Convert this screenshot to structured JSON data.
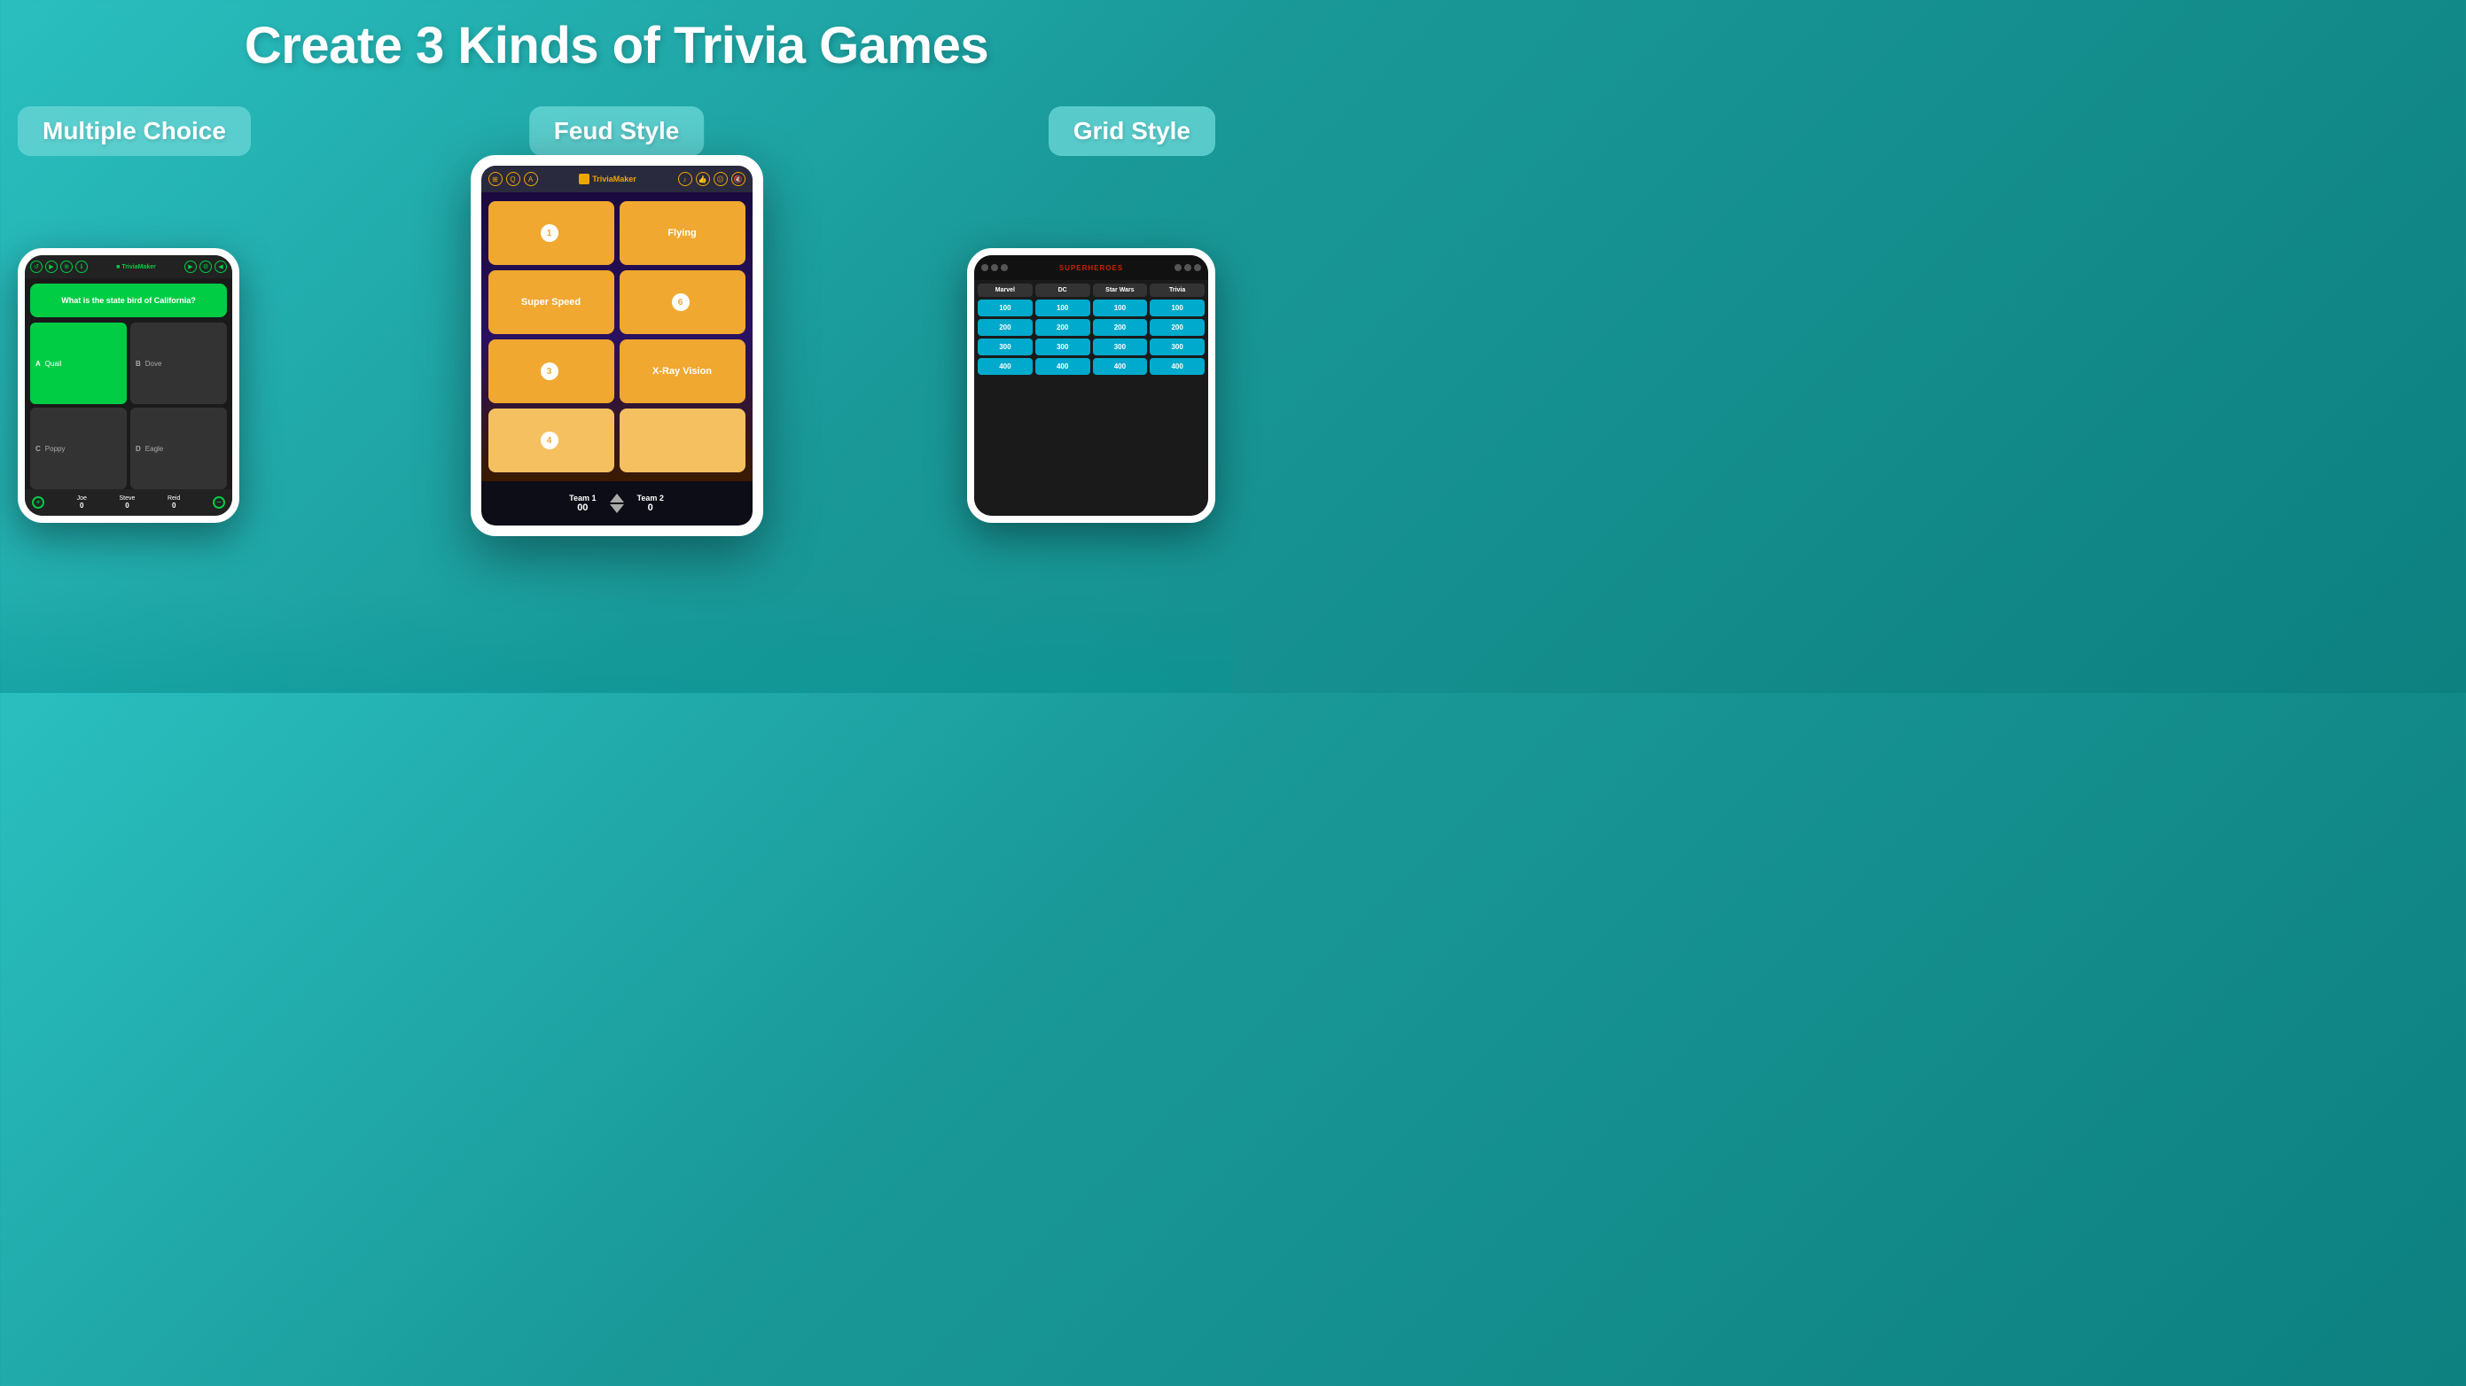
{
  "title": "Create 3 Kinds of Trivia Games",
  "badges": {
    "multiple_choice": "Multiple Choice",
    "feud_style": "Feud Style",
    "grid_style": "Grid Style"
  },
  "feud": {
    "app_name": "TriviaMaker",
    "cells": [
      {
        "type": "number",
        "value": "1"
      },
      {
        "type": "answer",
        "value": "Flying"
      },
      {
        "type": "answer",
        "value": "Super Speed"
      },
      {
        "type": "number",
        "value": "6"
      },
      {
        "type": "number",
        "value": "3"
      },
      {
        "type": "answer",
        "value": "X-Ray Vision"
      },
      {
        "type": "number",
        "value": "4"
      },
      {
        "type": "empty",
        "value": ""
      }
    ],
    "team1": {
      "label": "Team 1",
      "score": "00"
    },
    "team2": {
      "label": "Team 2",
      "score": "0"
    }
  },
  "multiple_choice": {
    "app_name": "TriviaMaker",
    "question": "What is the state bird of California?",
    "answers": [
      {
        "letter": "A",
        "text": "Quail",
        "correct": true
      },
      {
        "letter": "B",
        "text": "Dove",
        "correct": false
      },
      {
        "letter": "C",
        "text": "Poppy",
        "correct": false
      },
      {
        "letter": "D",
        "text": "Eagle",
        "correct": false
      }
    ],
    "players": [
      {
        "name": "Joe",
        "score": "0"
      },
      {
        "name": "Steve",
        "score": "0"
      },
      {
        "name": "Reid",
        "score": "0"
      }
    ]
  },
  "grid": {
    "app_name": "SUPERHEROES",
    "columns": [
      "Marvel",
      "DC",
      "Star Wars",
      "Trivia"
    ],
    "rows": [
      [
        "100",
        "100",
        "100",
        "100"
      ],
      [
        "200",
        "200",
        "200",
        "200"
      ],
      [
        "300",
        "300",
        "300",
        "300"
      ],
      [
        "400",
        "400",
        "400",
        "400"
      ]
    ]
  }
}
